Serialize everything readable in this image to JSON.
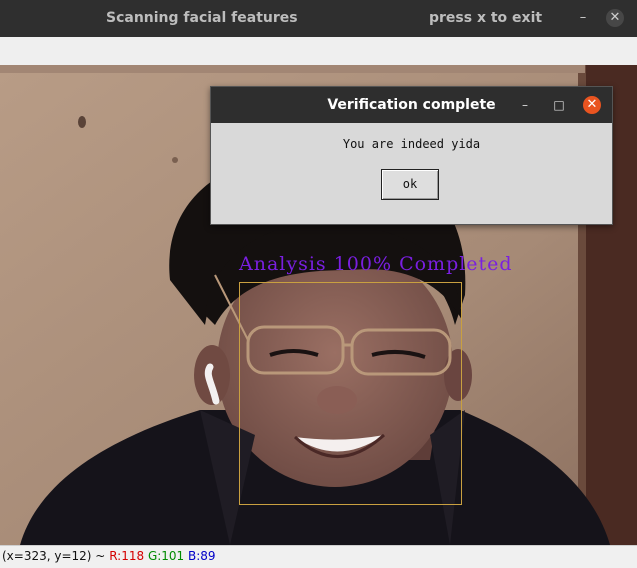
{
  "window": {
    "title": "Scanning facial features",
    "hint": "press x to exit",
    "minimize_glyph": "–",
    "close_glyph": "✕"
  },
  "overlay": {
    "analysis_text": "Analysis 100% Completed",
    "label_color": "#7a1fe0",
    "box_color": "#c9a040"
  },
  "dialog": {
    "title": "Verification complete",
    "message": "You are indeed yida",
    "ok_label": "ok",
    "minimize_glyph": "–",
    "maximize_glyph": "□",
    "close_glyph": "✕",
    "close_color": "#e95420"
  },
  "status": {
    "coords": "(x=323, y=12) ~",
    "r": "R:118",
    "g": "G:101",
    "b": "B:89"
  }
}
